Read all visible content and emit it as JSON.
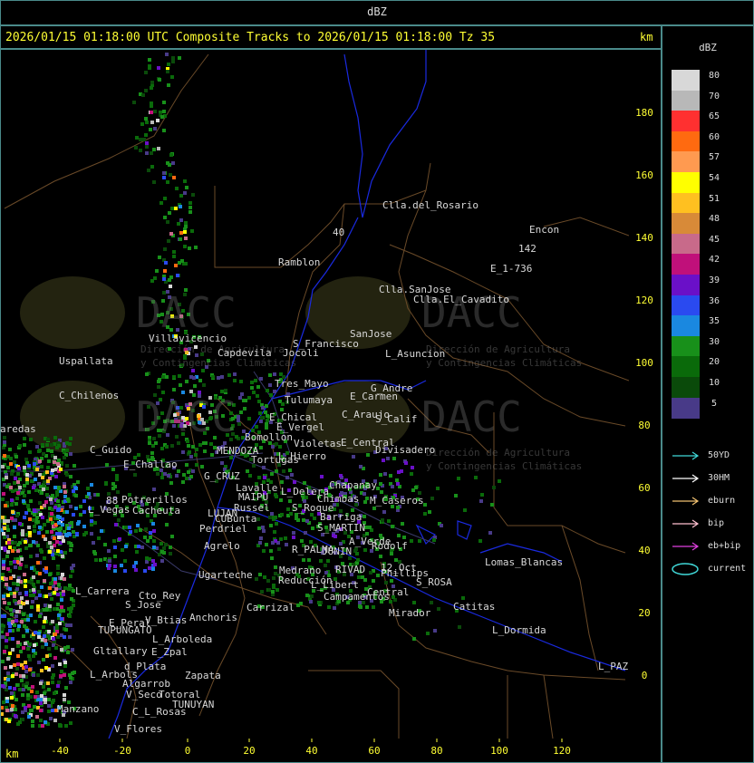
{
  "window_title": "dBZ",
  "map_title": "2026/01/15 01:18:00 UTC Composite Tracks to 2026/01/15 01:18:00 Tz 35",
  "axis_unit": "km",
  "y_ticks": [
    "180",
    "160",
    "140",
    "120",
    "100",
    "80",
    "60",
    "40",
    "20",
    "0"
  ],
  "x_ticks": [
    "-40",
    "-20",
    "0",
    "20",
    "40",
    "60",
    "80",
    "100",
    "120"
  ],
  "legend": {
    "title": "dBZ",
    "scale": [
      {
        "label": "80",
        "color": "#d8d8d8"
      },
      {
        "label": "70",
        "color": "#b8b8b8"
      },
      {
        "label": "65",
        "color": "#ff3030"
      },
      {
        "label": "60",
        "color": "#ff6a10"
      },
      {
        "label": "57",
        "color": "#ff9a50"
      },
      {
        "label": "54",
        "color": "#ffff00"
      },
      {
        "label": "51",
        "color": "#ffc020"
      },
      {
        "label": "48",
        "color": "#d88a38"
      },
      {
        "label": "45",
        "color": "#c86a8a"
      },
      {
        "label": "42",
        "color": "#c0107a"
      },
      {
        "label": "39",
        "color": "#6a10c8"
      },
      {
        "label": "36",
        "color": "#2a4af0"
      },
      {
        "label": "35",
        "color": "#1a88e0"
      },
      {
        "label": "30",
        "color": "#18901a"
      },
      {
        "label": "20",
        "color": "#0a6a0a"
      },
      {
        "label": "10",
        "color": "#0a4a0a"
      },
      {
        "label": "5",
        "color": "#483a88"
      }
    ],
    "tracks": [
      {
        "label": "50YD",
        "color": "#40d8d8"
      },
      {
        "label": "30HM",
        "color": "#ffffff"
      },
      {
        "label": "eburn",
        "color": "#f0c070"
      },
      {
        "label": "bip",
        "color": "#ffc0d0"
      },
      {
        "label": "eb+bip",
        "color": "#e040e0"
      },
      {
        "label": "current",
        "color": "#40d8d8"
      }
    ]
  },
  "watermark": {
    "text": "DACC",
    "subtitle_1": "Dirección de Agricultura",
    "subtitle_2": "y Contingencias Climáticas"
  },
  "places": [
    "Clla.del_Rosario",
    "Encon",
    "142",
    "E_1-736",
    "Ramblon",
    "Clla.SanJose",
    "Clla.El_Cavadito",
    "S_Francisco",
    "SanJose",
    "L_Asuncion",
    "Villavicencio",
    "Capdevila",
    "Uspallata",
    "Jocoli",
    "Tres_Mayo",
    "Tulumaya",
    "G_Andre",
    "E_Carmen",
    "C_Chilenos",
    "E_Chical",
    "C_Araujo",
    "S_Calif",
    "aredas",
    "E_Vergel",
    "Bomollon",
    "Violetas",
    "E_Central",
    "Divisadero",
    "C_Guido",
    "L_Hierro",
    "E_Challao",
    "MENDOZA",
    "Tortugas",
    "G_CRUZ",
    "Chapanay",
    "Lavalle",
    "L_Delera",
    "Chimbas",
    "M_Caseros",
    "Potrerillos",
    "MAIPU",
    "L_Vegas",
    "Cacheuta",
    "Russel",
    "S_Roque",
    "LUJAN",
    "CUBunta",
    "Barriga",
    "Perdriel",
    "S_MARTIN",
    "A_Verde",
    "Rodolf",
    "Agrelo",
    "R_PALMA",
    "JUNIN",
    "Lomas_Blancas",
    "12_Oct",
    "Ugarteche",
    "Medrano",
    "RIVAD",
    "Phillips",
    "S_ROSA",
    "L_Carrera",
    "Cto_Rey",
    "Anchoris",
    "Reducción",
    "L_Libert",
    "Central",
    "S_Jose",
    "Campamentos",
    "Catitas",
    "Carrizal",
    "V_Btias",
    "Mirador",
    "E_Peral",
    "TUPUNGATO",
    "L_Dormida",
    "L_Arboleda",
    "Gltallary",
    "E_Zpal",
    "L_PAZ",
    "d_Plata",
    "L_Arbols",
    "Zapata",
    "Algarrob",
    "V_Seco",
    "Totoral",
    "TUNUYAN",
    "Manzano",
    "C_L_Rosas",
    "V_Flores",
    "88",
    "40"
  ]
}
